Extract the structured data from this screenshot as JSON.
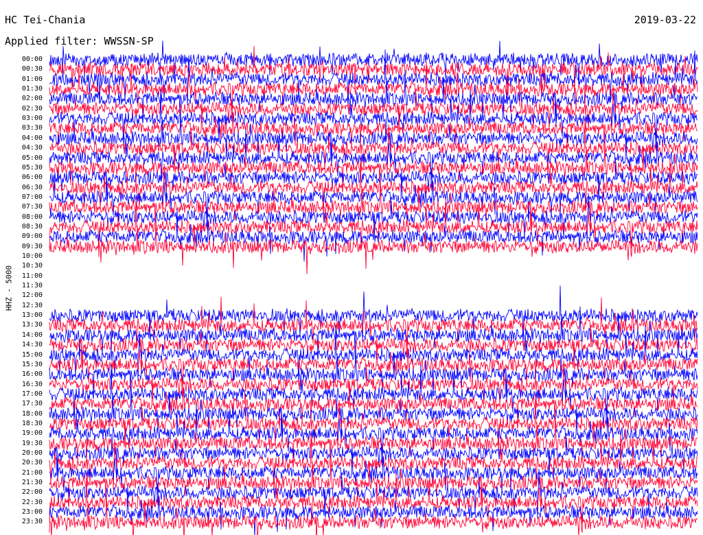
{
  "header": {
    "station": "HC Tei-Chania",
    "date": "2019-03-22",
    "filter": "Applied filter: WWSSN-SP"
  },
  "chart_data": {
    "type": "line",
    "title": "HC Tei-Chania",
    "ylabel": "HHZ - 5000",
    "row_labels": [
      "00:00",
      "00:30",
      "01:00",
      "01:30",
      "02:00",
      "02:30",
      "03:00",
      "03:30",
      "04:00",
      "04:30",
      "05:00",
      "05:30",
      "06:00",
      "06:30",
      "07:00",
      "07:30",
      "08:00",
      "08:30",
      "09:00",
      "09:30",
      "10:00",
      "10:30",
      "11:00",
      "11:30",
      "12:00",
      "12:30",
      "13:00",
      "13:30",
      "14:00",
      "14:30",
      "15:00",
      "15:30",
      "16:00",
      "16:30",
      "17:00",
      "17:30",
      "18:00",
      "18:30",
      "19:00",
      "19:30",
      "20:00",
      "20:30",
      "21:00",
      "21:30",
      "22:00",
      "22:30",
      "23:00",
      "23:30"
    ],
    "series_colors": [
      "#0000ff",
      "#ff0033"
    ],
    "gaps": [
      {
        "start": "10:00",
        "end": "13:00",
        "description": "no data"
      }
    ],
    "grid": false,
    "legend": "none"
  }
}
